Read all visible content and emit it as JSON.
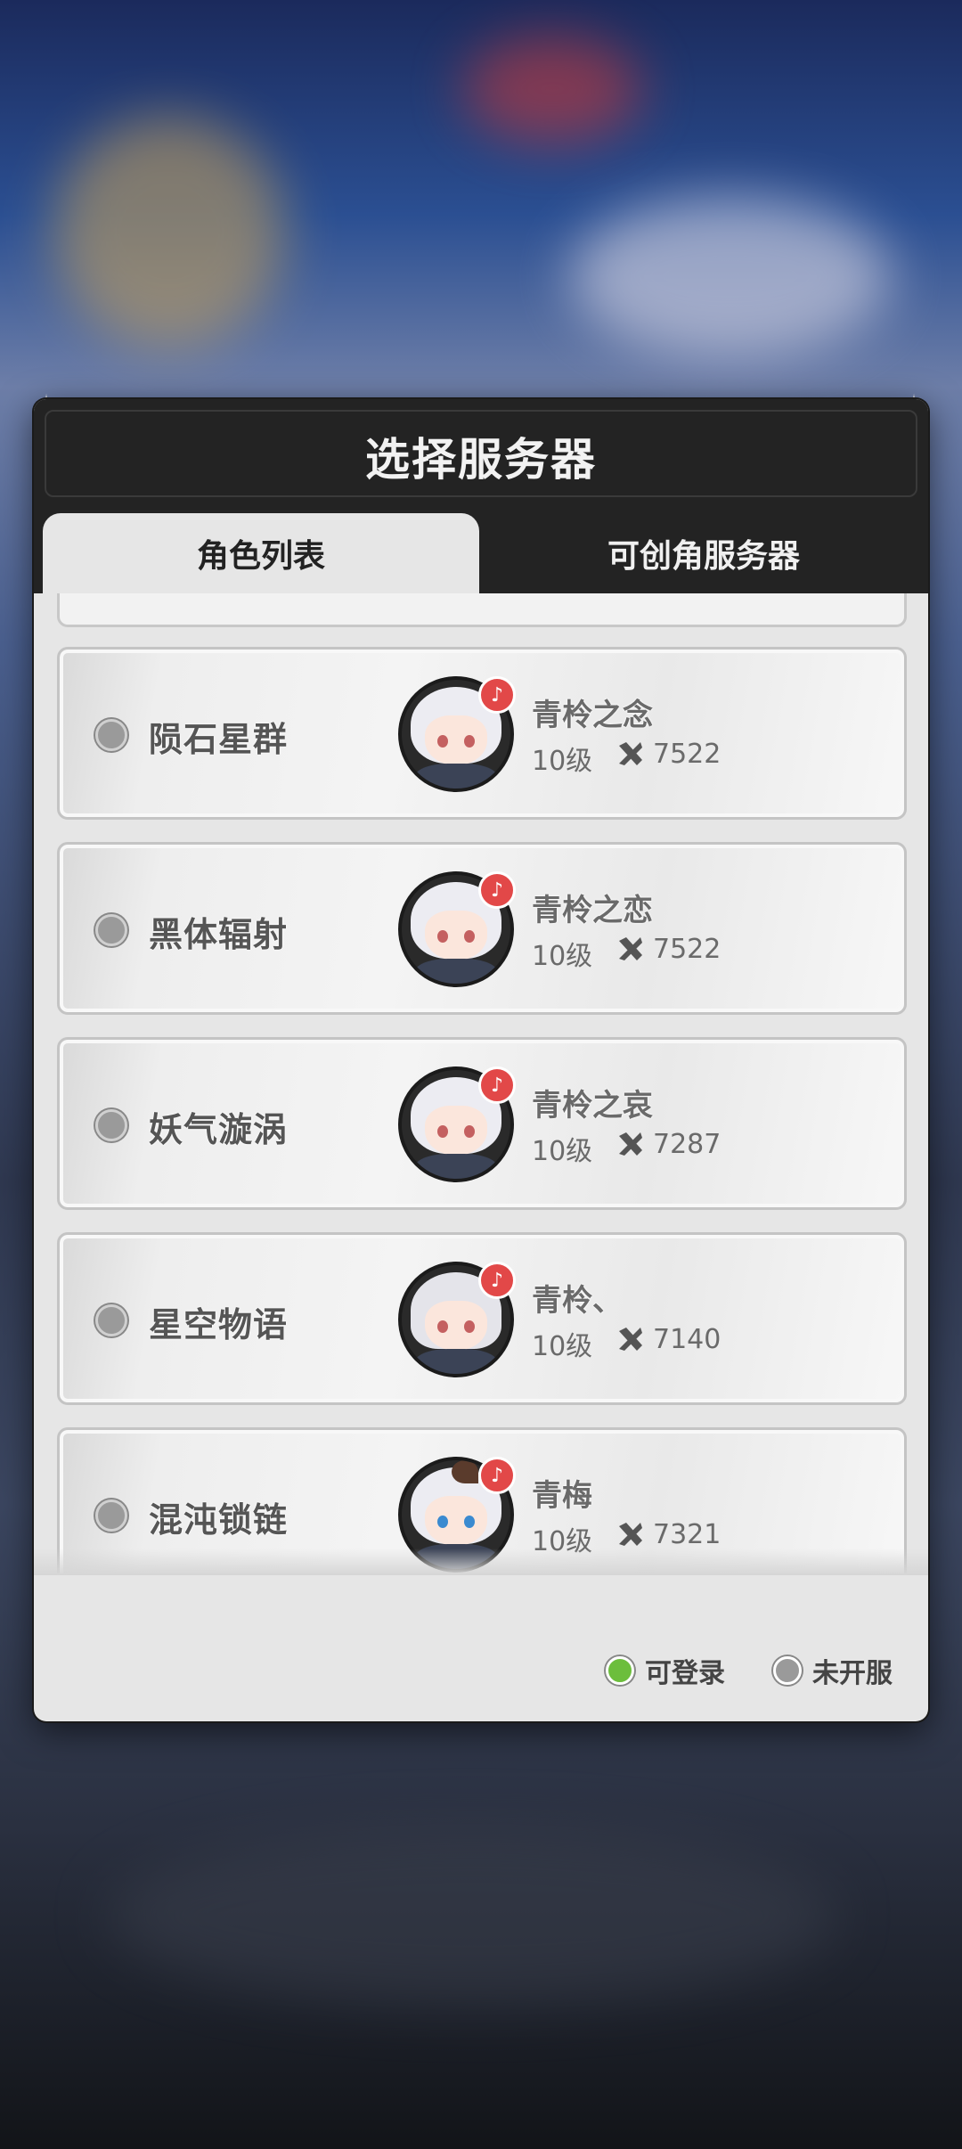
{
  "dialog": {
    "title": "选择服务器",
    "tabs": [
      {
        "label": "角色列表",
        "active": true
      },
      {
        "label": "可创角服务器",
        "active": false
      }
    ]
  },
  "servers": [
    {
      "server": "陨石星群",
      "character": "青柃之念",
      "level": "10级",
      "power": "7522",
      "avatar": "white-hair-red-eyes"
    },
    {
      "server": "黑体辐射",
      "character": "青柃之恋",
      "level": "10级",
      "power": "7522",
      "avatar": "white-hair-red-eyes"
    },
    {
      "server": "妖气漩涡",
      "character": "青柃之哀",
      "level": "10级",
      "power": "7287",
      "avatar": "white-hair-red-eyes"
    },
    {
      "server": "星空物语",
      "character": "青柃、",
      "level": "10级",
      "power": "7140",
      "avatar": "white-hair-hood"
    },
    {
      "server": "混沌锁链",
      "character": "青梅",
      "level": "10级",
      "power": "7321",
      "avatar": "white-hair-blue-eyes"
    }
  ],
  "legend": {
    "available": "可登录",
    "not_open": "未开服"
  },
  "colors": {
    "available": "#6cbe3c",
    "not_open": "#9a9a9a",
    "badge": "#e24848"
  },
  "icons": {
    "badge": "carrot-badge-icon",
    "power": "crossed-tools-icon"
  }
}
